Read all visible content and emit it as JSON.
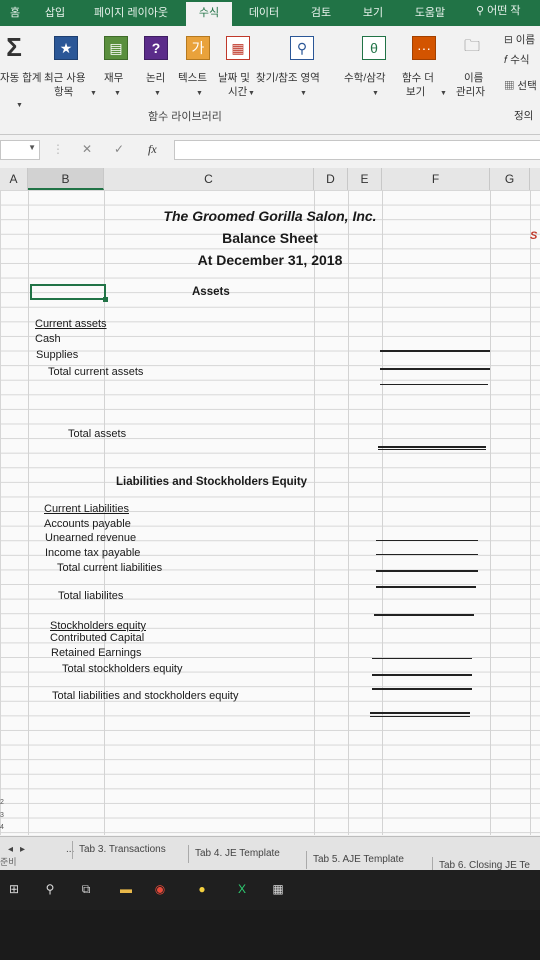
{
  "menu": {
    "tabs": [
      "홈",
      "삽입",
      "페이지 레이아웃",
      "수식",
      "데이터",
      "검토",
      "보기",
      "도움말"
    ],
    "active": "수식",
    "search": "어떤 작"
  },
  "ribbon": {
    "buttons": [
      {
        "label1": "자동 합계",
        "label2": "",
        "icon": "sigma-icon"
      },
      {
        "label1": "최근 사용",
        "label2": "항목",
        "icon": "star-icon"
      },
      {
        "label1": "재무",
        "label2": "",
        "icon": "book-icon"
      },
      {
        "label1": "논리",
        "label2": "",
        "icon": "question-icon"
      },
      {
        "label1": "텍스트",
        "label2": "",
        "icon": "text-icon"
      },
      {
        "label1": "날짜 및",
        "label2": "시간",
        "icon": "calendar-icon"
      },
      {
        "label1": "찾기/참조 영역",
        "label2": "",
        "icon": "magnifier-icon"
      },
      {
        "label1": "수학/삼각",
        "label2": "",
        "icon": "theta-icon"
      },
      {
        "label1": "함수 더",
        "label2": "보기",
        "icon": "more-icon"
      },
      {
        "label1": "이름",
        "label2": "관리자",
        "icon": "name-manager-icon"
      }
    ],
    "group_label": "함수 라이브러리",
    "right_items": [
      "이름",
      "수식",
      "선택",
      "정의"
    ]
  },
  "formula": {
    "cancel": "✕",
    "enter": "✓",
    "fx": "fx"
  },
  "columns": [
    "A",
    "B",
    "C",
    "D",
    "E",
    "F",
    "G"
  ],
  "sheet": {
    "title1": "The Groomed Gorilla Salon, Inc.",
    "title2": "Balance Sheet",
    "title3": "At December 31, 2018",
    "assets_header": "Assets",
    "current_assets": "Current assets",
    "cash": "Cash",
    "supplies": "Supplies",
    "total_current_assets": "Total current assets",
    "total_assets": "Total assets",
    "liab_header": "Liabilities and Stockholders Equity",
    "current_liabilities": "Current Liabilities",
    "accounts_payable": "Accounts payable",
    "unearned_revenue": "Unearned revenue",
    "income_tax_payable": "Income tax payable",
    "total_current_liabilities": "Total current liabilities",
    "total_liabilities": "Total liabilites",
    "stockholders_equity": "Stockholders equity",
    "contributed_capital": "Contributed Capital",
    "retained_earnings": "Retained Earnings",
    "total_stockholders_equity": "Total stockholders equity",
    "total_liab_equity": "Total liabilities and stockholders equity",
    "row_numbers": [
      "2",
      "3",
      "4"
    ],
    "edge_char": "S"
  },
  "tabs": {
    "ellipsis": "...",
    "items": [
      "Tab 3. Transactions",
      "Tab 4. JE Template",
      "Tab 5. AJE Template",
      "Tab 6. Closing JE Te"
    ],
    "status": "준비"
  },
  "taskbar": {
    "icons": [
      "windows-icon",
      "search-icon",
      "task-view-icon",
      "file-explorer-icon",
      "chrome-icon",
      "kakaotalk-icon",
      "excel-icon",
      "calculator-icon"
    ]
  }
}
